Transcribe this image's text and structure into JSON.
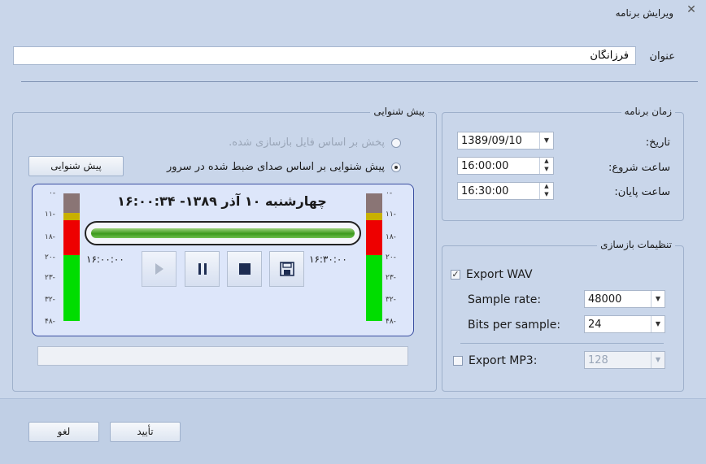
{
  "window": {
    "title": "ویرایش برنامه",
    "close_glyph": "✕"
  },
  "name": {
    "label": "عنوان",
    "value": "فرزانگان"
  },
  "preview": {
    "legend": "پیش شنوایی",
    "radio_file_label": "پخش بر اساس فایل بازسازی شده.",
    "radio_server_label": "پیش شنوایی بر اساس صدای ضبط شده در سرور",
    "button_label": "پیش شنوایی",
    "player": {
      "datetime_text": "چهارشنبه ۱۰ آذر ۱۳۸۹- ۱۶:۰۰:۳۴",
      "time_start": "۱۶:۰۰:۰۰",
      "time_end": "۱۶:۳۰:۰۰",
      "meter_ticks": [
        "۰-",
        "۱۱-",
        "۱۸-",
        "۲۰-",
        "۲۳-",
        "۳۲-",
        "۴۸-"
      ],
      "meter_colors": {
        "low": "#00dd00",
        "mid": "#ee0000",
        "peak": "#c8b000",
        "top": "#8a7575"
      }
    }
  },
  "schedule": {
    "legend": "زمان برنامه",
    "date_label": "تاریخ:",
    "date_value": "1389/09/10",
    "start_label": "ساعت شروع:",
    "start_value": "16:00:00",
    "end_label": "ساعت پایان:",
    "end_value": "16:30:00"
  },
  "rebuild": {
    "legend": "تنظیمات بازسازی",
    "export_wav_label": "Export WAV",
    "export_wav_checked": true,
    "sample_rate_label": "Sample rate:",
    "sample_rate_value": "48000",
    "bits_label": "Bits per sample:",
    "bits_value": "24",
    "export_mp3_label": "Export MP3:",
    "export_mp3_checked": false,
    "mp3_value": "128"
  },
  "footer": {
    "ok_label": "تأیید",
    "cancel_label": "لغو"
  },
  "icons": {
    "checkmark": "✓",
    "spin_up": "▲",
    "spin_down": "▼",
    "dropdown": "▼"
  }
}
